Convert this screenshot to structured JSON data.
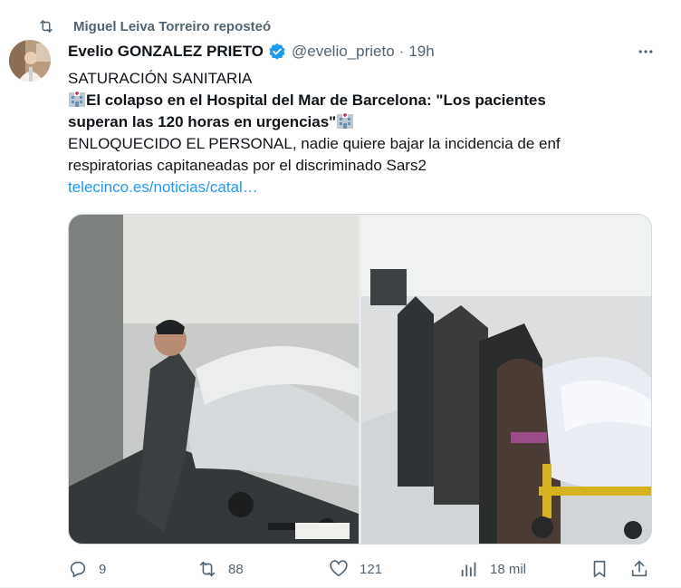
{
  "repost": {
    "text": "Miguel Leiva Torreiro reposteó",
    "icon": "repost-icon"
  },
  "author": {
    "name": "Evelio GONZALEZ PRIETO",
    "handle": "@evelio_prieto",
    "separator": "·",
    "time": "19h",
    "verified": true
  },
  "tweet": {
    "line1": "SATURACIÓN SANITARIA",
    "headline_line1": "El colapso en el Hospital del Mar de Barcelona: \"Los pacientes",
    "headline_line2": "superan las 120 horas en urgencias\"",
    "body_line1": "ENLOQUECIDO EL PERSONAL, nadie quiere bajar la incidencia de enf",
    "body_line2": "respiratorias capitaneadas por el discriminado Sars2",
    "link": "telecinco.es/noticias/catal…"
  },
  "actions": {
    "replies": "9",
    "reposts": "88",
    "likes": "121",
    "views": "18 mil"
  },
  "colors": {
    "text": "#0f1419",
    "secondary": "#536471",
    "link": "#1d9bf0",
    "verified": "#1d9bf0",
    "border": "#cfd9de"
  }
}
